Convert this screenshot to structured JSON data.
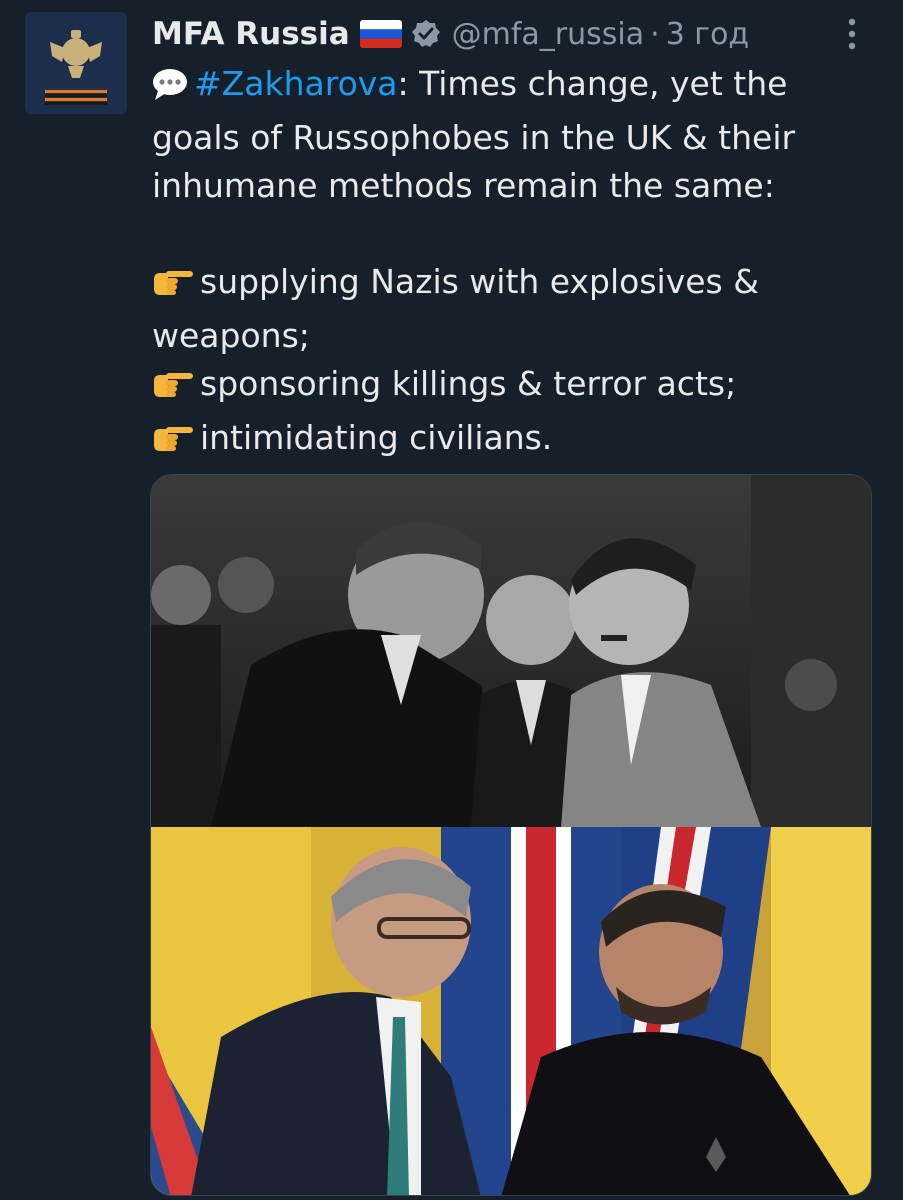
{
  "tweet": {
    "author": {
      "name": "MFA Russia",
      "handle": "@mfa_russia",
      "time": "3 год",
      "flag_icon": "russia-flag-icon",
      "verified_icon": "verified-badge-icon",
      "avatar_icon": "coat-of-arms-avatar"
    },
    "text": {
      "emoji_speech": "speech-bubble-icon",
      "hashtag": "#Zakharova",
      "line1_rest": ": Times change, yet the",
      "line2": "goals of Russophobes in the UK & their",
      "line3": "inhumane methods remain the same:",
      "bullet_icon": "pointing-hand-icon",
      "bullet1_a": "supplying Nazis with explosives &",
      "bullet1_b": "weapons;",
      "bullet2": "sponsoring killings & terror acts;",
      "bullet3": "intimidating civilians."
    },
    "media": {
      "top_photo": "black-and-white-historical-photo",
      "bottom_photo": "color-photo-two-leaders"
    }
  },
  "colors": {
    "background": "#15202b",
    "text": "#e7e9ea",
    "muted": "#8b98a5",
    "link": "#1d9bf0"
  }
}
